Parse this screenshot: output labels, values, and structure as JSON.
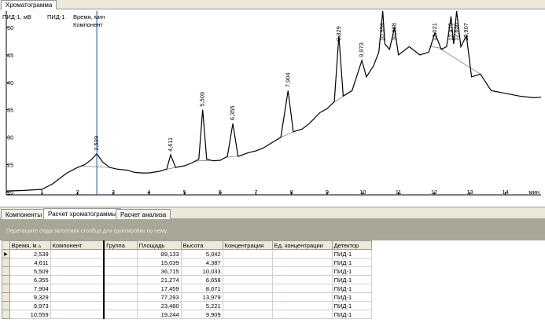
{
  "window": {
    "top_tab": "Хроматограмма"
  },
  "chart": {
    "channel_label": "ПИД-1, мВ",
    "detector_label": "ПИД-1",
    "cursor_time_label": "Время, мин",
    "cursor_component_label": "Компонент",
    "x_unit": "мин",
    "x_ticks": [
      "1",
      "2",
      "3",
      "4",
      "5",
      "6",
      "7",
      "8",
      "9",
      "10",
      "11",
      "12",
      "13",
      "14"
    ],
    "y_ticks": [
      "20",
      "25",
      "30",
      "35",
      "40",
      "45",
      "50"
    ],
    "peak_labels": [
      "2,539",
      "4,611",
      "5,509",
      "6,355",
      "7,904",
      "9,329",
      "9,973",
      "10,559",
      "10,888",
      "12,021",
      "12,475",
      "12,630",
      "12,907"
    ],
    "colors": {
      "trace": "#000000",
      "cursor": "#1f49b8",
      "baseline": "#777777"
    }
  },
  "chart_data": {
    "type": "line",
    "xlabel": "мин",
    "ylabel": "ПИД-1, мВ",
    "xlim": [
      0,
      15
    ],
    "ylim": [
      19.5,
      53
    ],
    "x": [
      0.0,
      0.5,
      1.0,
      1.3,
      1.7,
      2.0,
      2.2,
      2.4,
      2.539,
      2.7,
      2.9,
      3.1,
      3.4,
      3.6,
      3.8,
      4.0,
      4.3,
      4.5,
      4.611,
      4.75,
      5.0,
      5.2,
      5.4,
      5.509,
      5.62,
      5.8,
      6.0,
      6.2,
      6.355,
      6.5,
      6.8,
      7.0,
      7.2,
      7.5,
      7.7,
      7.904,
      8.05,
      8.3,
      8.5,
      8.8,
      9.0,
      9.2,
      9.329,
      9.45,
      9.7,
      9.973,
      10.1,
      10.3,
      10.45,
      10.559,
      10.62,
      10.75,
      10.888,
      11.0,
      11.3,
      11.6,
      11.85,
      12.021,
      12.2,
      12.35,
      12.475,
      12.55,
      12.63,
      12.75,
      12.907,
      13.05,
      13.3,
      13.6,
      14.0,
      14.4,
      14.8,
      15.0
    ],
    "series": [
      {
        "values": [
          20.2,
          20.3,
          20.5,
          21.5,
          23.5,
          24.5,
          25.0,
          26.0,
          27.0,
          25.5,
          24.5,
          24.2,
          24.0,
          23.6,
          23.5,
          23.5,
          23.8,
          24.2,
          26.8,
          24.5,
          24.8,
          25.3,
          26.0,
          35.0,
          26.0,
          25.7,
          25.8,
          26.5,
          32.5,
          26.5,
          27.2,
          27.5,
          28.0,
          29.2,
          30.0,
          38.5,
          31.0,
          31.5,
          32.5,
          34.5,
          35.2,
          36.5,
          48.5,
          37.5,
          38.5,
          44.0,
          41.0,
          43.0,
          45.5,
          53.0,
          47.0,
          46.0,
          50.0,
          45.0,
          46.5,
          45.0,
          45.5,
          49.0,
          46.0,
          46.5,
          52.0,
          47.0,
          53.0,
          46.5,
          48.5,
          41.0,
          41.5,
          38.5,
          38.0,
          37.5,
          37.2,
          37.3
        ]
      }
    ]
  },
  "panel_tabs": [
    {
      "label": "Компоненты"
    },
    {
      "label": "Расчет хроматограммы"
    },
    {
      "label": "Расчет анализа"
    }
  ],
  "grid": {
    "group_hint": "Перетащите сюда заголовок столбца для группировки по нему.",
    "columns": [
      "Время, м",
      "Компонент",
      "Группа",
      "Площадь",
      "Высота",
      "Концентрация",
      "Ед. концентрации",
      "Детектор"
    ],
    "rows": [
      [
        "2,539",
        "",
        "",
        "89,133",
        "5,042",
        "",
        "",
        "ПИД-1"
      ],
      [
        "4,611",
        "",
        "",
        "15,039",
        "4,387",
        "",
        "",
        "ПИД-1"
      ],
      [
        "5,509",
        "",
        "",
        "36,715",
        "10,033",
        "",
        "",
        "ПИД-1"
      ],
      [
        "6,355",
        "",
        "",
        "21,274",
        "6,658",
        "",
        "",
        "ПИД-1"
      ],
      [
        "7,904",
        "",
        "",
        "17,459",
        "8,671",
        "",
        "",
        "ПИД-1"
      ],
      [
        "9,329",
        "",
        "",
        "77,293",
        "13,979",
        "",
        "",
        "ПИД-1"
      ],
      [
        "9,973",
        "",
        "",
        "23,480",
        "5,221",
        "",
        "",
        "ПИД-1"
      ],
      [
        "10,559",
        "",
        "",
        "19,244",
        "9,909",
        "",
        "",
        "ПИД-1"
      ]
    ]
  }
}
